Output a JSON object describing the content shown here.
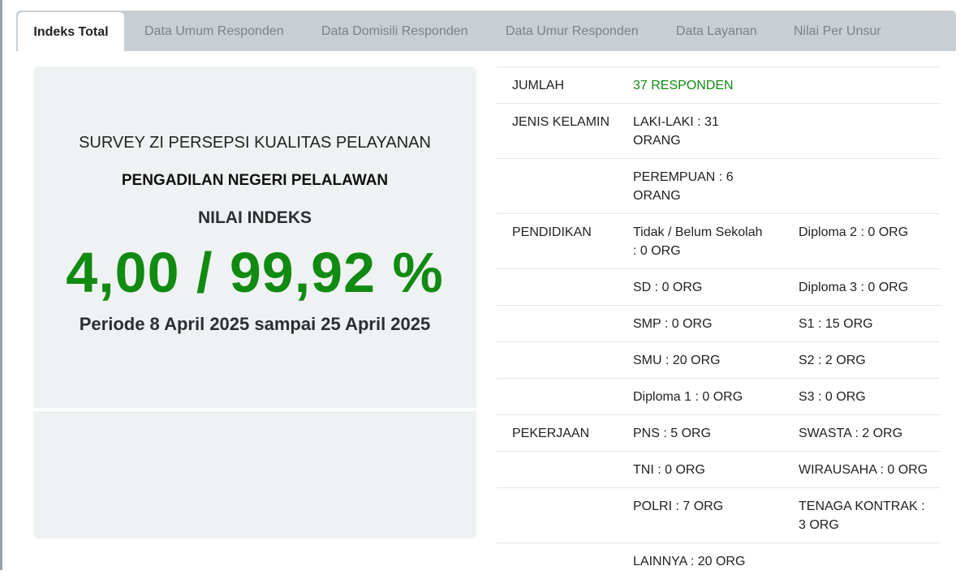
{
  "tabs": [
    {
      "label": "Indeks Total",
      "active": true
    },
    {
      "label": "Data Umum Responden"
    },
    {
      "label": "Data Domisili Responden"
    },
    {
      "label": "Data Umur Responden"
    },
    {
      "label": "Data Layanan"
    },
    {
      "label": "Nilai Per Unsur"
    }
  ],
  "summary": {
    "survey_title": "SURVEY ZI PERSEPSI KUALITAS PELAYANAN",
    "institution": "PENGADILAN NEGERI PELALAWAN",
    "index_label": "NILAI INDEKS",
    "index_value": "4,00 / 99,92 %",
    "period": "Periode 8 April 2025 sampai 25 April 2025"
  },
  "respondents": {
    "jumlah_label": "JUMLAH",
    "jumlah_value": "37 RESPONDEN",
    "gender_label": "JENIS KELAMIN",
    "gender": [
      "LAKI-LAKI : 31 ORANG",
      "PEREMPUAN : 6 ORANG"
    ],
    "education_label": "PENDIDIKAN",
    "education": [
      [
        "Tidak / Belum Sekolah : 0 ORG",
        "Diploma 2 : 0 ORG"
      ],
      [
        "SD : 0 ORG",
        "Diploma 3 : 0 ORG"
      ],
      [
        "SMP : 0 ORG",
        "S1 : 15 ORG"
      ],
      [
        "SMU : 20 ORG",
        "S2 : 2 ORG"
      ],
      [
        "Diploma 1 : 0 ORG",
        "S3 : 0 ORG"
      ]
    ],
    "job_label": "PEKERJAAN",
    "jobs": [
      [
        "PNS : 5 ORG",
        "SWASTA : 2 ORG"
      ],
      [
        "TNI : 0 ORG",
        "WIRAUSAHA : 0 ORG"
      ],
      [
        "POLRI : 7 ORG",
        "TENAGA KONTRAK : 3 ORG"
      ],
      [
        "LAINNYA : 20 ORG",
        ""
      ]
    ]
  },
  "colors": {
    "accent_green": "#118a11",
    "tabbar": "#c8cfd3",
    "panel": "#eff2f3"
  }
}
